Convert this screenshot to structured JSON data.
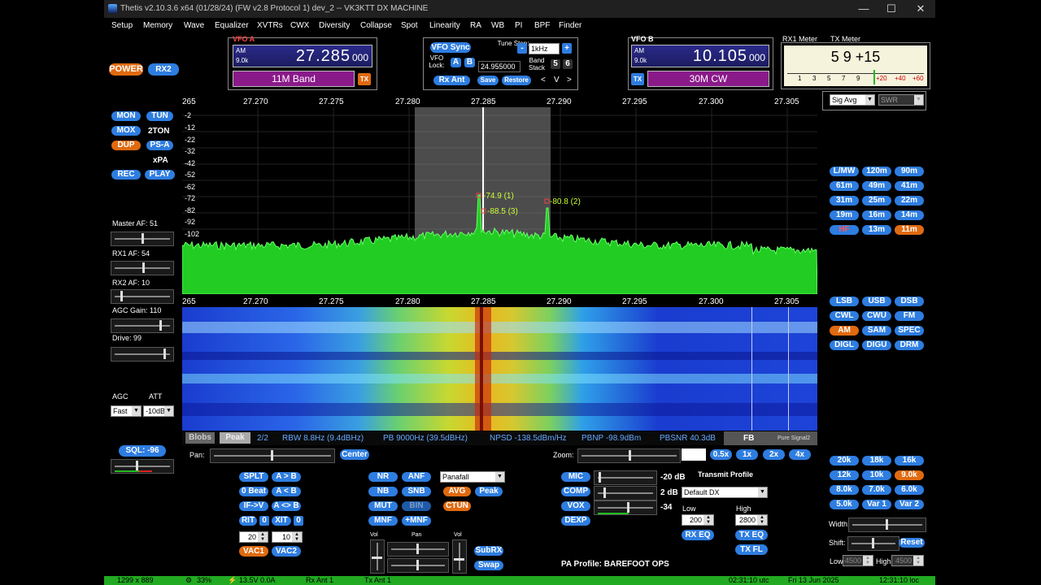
{
  "window": {
    "title": "Thetis v2.10.3.6 x64 (01/28/24) (FW v2.8 Protocol 1) dev_2  --  VK3KTT DX MACHINE",
    "min": "—",
    "max": "☐",
    "close": "✕"
  },
  "menu": [
    "Setup",
    "Memory",
    "Wave",
    "Equalizer",
    "XVTRs",
    "CWX",
    "Diversity",
    "Collapse",
    "Spot",
    "Linearity",
    "RA",
    "WB",
    "PI",
    "BPF",
    "Finder"
  ],
  "vfoA": {
    "label": "VFO A",
    "mode": "AM",
    "step": "9.0k",
    "freq_main": "27.285",
    "freq_sub": "000",
    "band": "11M Band",
    "tx": "TX"
  },
  "vfoB": {
    "label": "VFO B",
    "mode": "AM",
    "step": "9.0k",
    "freq_main": "10.105",
    "freq_sub": "000",
    "band": "30M CW",
    "tx": "TX"
  },
  "center": {
    "vfo_sync": "VFO Sync",
    "tune_step": "Tune Step:",
    "tune_minus": "-",
    "tune_value": "1kHz",
    "tune_plus": "+",
    "vfo_lock": "VFO Lock:",
    "lock_a": "A",
    "lock_b": "B",
    "lock_freq": "24.955000",
    "band_stack": "Band Stack",
    "bs5": "5",
    "bs6": "6",
    "rx_ant": "Rx Ant",
    "save": "Save",
    "restore": "Restore",
    "nav_prev": "<",
    "nav_v": "V",
    "nav_next": ">"
  },
  "meters": {
    "rx1_label": "RX1 Meter",
    "tx_label": "TX Meter",
    "reading": "5 9 +15",
    "scale": [
      "1",
      "3",
      "5",
      "7",
      "9",
      "+20",
      "+40",
      "+60"
    ],
    "rx_mode": "Sig Avg",
    "tx_mode": "SWR"
  },
  "left": {
    "power": "POWER",
    "rx2": "RX2",
    "mon": "MON",
    "tun": "TUN",
    "mox": "MOX",
    "tone": "2TON",
    "dup": "DUP",
    "psa": "PS-A",
    "xpa": "xPA",
    "rec": "REC",
    "play": "PLAY",
    "master_af": "Master AF:  51",
    "rx1_af": "RX1 AF:  54",
    "rx2_af": "RX2 AF:  10",
    "agc_gain": "AGC Gain:  110",
    "drive": "Drive:  99",
    "agc": "AGC",
    "att": "ATT",
    "agc_value": "Fast",
    "att_value": "-10dB",
    "sql": "SQL: -96",
    "levels": {
      "master_af": 0.5,
      "rx1_af": 0.52,
      "rx2_af": 0.1,
      "agc_gain": 0.85,
      "drive": 0.92
    }
  },
  "pan_scale": [
    "265",
    "27.270",
    "27.275",
    "27.280",
    "27.285",
    "27.290",
    "27.295",
    "27.300",
    "27.305"
  ],
  "db_scale": [
    "-2",
    "-12",
    "-22",
    "-32",
    "-42",
    "-52",
    "-62",
    "-72",
    "-82",
    "-92",
    "-102"
  ],
  "markers": [
    {
      "text": "-74.9 (1)"
    },
    {
      "text": "-88.5 (3)"
    },
    {
      "text": "-80.8 (2)"
    }
  ],
  "infobar": {
    "blobs": "Blobs",
    "peak": "Peak",
    "count": "2/2",
    "rbw": "RBW 8.8Hz (9.4dBHz)",
    "pb": "PB 9000Hz (39.5dBHz)",
    "npsd": "NPSD -138.5dBm/Hz",
    "pbnp": "PBNP -98.9dBm",
    "pbsnr": "PBSNR 40.3dB",
    "fb": "FB",
    "ps": "Pure Signal2"
  },
  "panrow": {
    "pan": "Pan:",
    "center": "Center",
    "zoom": "Zoom:",
    "z05": "0.5x",
    "z1": "1x",
    "z2": "2x",
    "z4": "4x"
  },
  "bands": [
    [
      "L/MW",
      "120m",
      "90m"
    ],
    [
      "61m",
      "49m",
      "41m"
    ],
    [
      "31m",
      "25m",
      "22m"
    ],
    [
      "19m",
      "16m",
      "14m"
    ],
    [
      "HF",
      "13m",
      "11m"
    ]
  ],
  "modes": [
    [
      "LSB",
      "USB",
      "DSB"
    ],
    [
      "CWL",
      "CWU",
      "FM"
    ],
    [
      "AM",
      "SAM",
      "SPEC"
    ],
    [
      "DIGL",
      "DIGU",
      "DRM"
    ]
  ],
  "filters": [
    [
      "20k",
      "18k",
      "16k"
    ],
    [
      "12k",
      "10k",
      "9.0k"
    ],
    [
      "8.0k",
      "7.0k",
      "6.0k"
    ],
    [
      "5.0k",
      "Var 1",
      "Var 2"
    ]
  ],
  "filterctl": {
    "width": "Width:",
    "shift": "Shift:",
    "reset": "Reset",
    "low": "Low",
    "high": "High",
    "low_val": "-4500",
    "high_val": "4500"
  },
  "bottom": {
    "splt": "SPLT",
    "atob": "A > B",
    "zerobeat": "0 Beat",
    "alessb": "A < B",
    "ifv": "IF->V",
    "aswapb": "A <> B",
    "rit": "RIT",
    "rit_val": "0",
    "xit": "XIT",
    "xit_val": "0",
    "rit_step": "20",
    "xit_step": "10",
    "vac1": "VAC1",
    "vac2": "VAC2",
    "nr": "NR",
    "anf": "ANF",
    "nb": "NB",
    "snb": "SNB",
    "mut": "MUT",
    "bin": "BIN",
    "mnf": "MNF",
    "pmnf": "+MNF",
    "display": "Panafall",
    "avg": "AVG",
    "peak": "Peak",
    "ctun": "CTUN",
    "vol": "Vol",
    "pan": "Pan",
    "vol2": "Vol",
    "subrx": "SubRX",
    "swap": "Swap",
    "mic": "MIC",
    "mic_db": "-20 dB",
    "comp": "COMP",
    "comp_db": "2 dB",
    "vox": "VOX",
    "vox_val": "-34",
    "dexp": "DEXP",
    "tx_profile": "Transmit Profile",
    "tx_profile_val": "Default DX",
    "low": "Low",
    "high": "High",
    "low_val": "200",
    "high_val": "2800",
    "rxeq": "RX EQ",
    "txeq": "TX EQ",
    "txfl": "TX FL",
    "pa_profile": "PA Profile: BAREFOOT OPS"
  },
  "statusbar": {
    "res": "1299 x 889",
    "cpu": "33%",
    "volt": "13.5V  0.0A",
    "rxant": "Rx Ant 1",
    "txant": "Tx Ant 1",
    "time_utc": "02:31:10 utc",
    "date": "Fri 13 Jun 2025",
    "time_loc": "12:31:10 loc"
  },
  "colors": {
    "accent": "#2e7de0",
    "active": "#e06a10",
    "spectrum": "#22cc22",
    "status": "#22aa22"
  }
}
